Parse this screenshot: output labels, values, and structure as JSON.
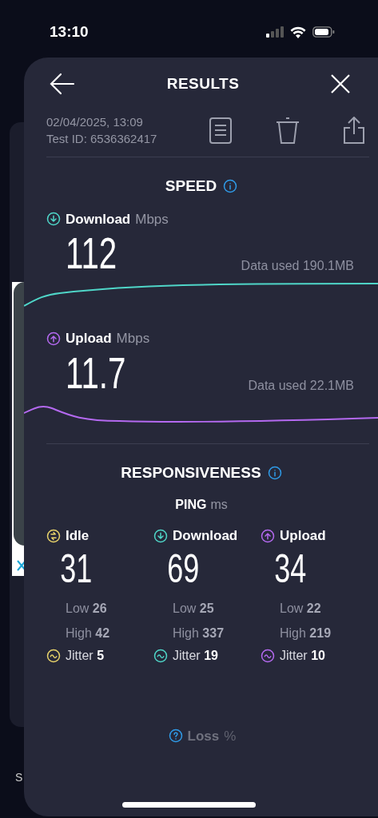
{
  "status_bar": {
    "time": "13:10"
  },
  "background_card": {
    "label": "S"
  },
  "header": {
    "title": "RESULTS"
  },
  "test_info": {
    "date": "02/04/2025, 13:09",
    "test_id": "Test ID: 6536362417"
  },
  "speed": {
    "title": "SPEED",
    "metrics": [
      {
        "kind": "download",
        "label": "Download",
        "unit": "Mbps",
        "value": "112",
        "data_used": "Data used 190.1MB",
        "color": "#4fd6c8"
      },
      {
        "kind": "upload",
        "label": "Upload",
        "unit": "Mbps",
        "value": "11.7",
        "data_used": "Data used 22.1MB",
        "color": "#b469f0"
      }
    ]
  },
  "responsiveness": {
    "title": "RESPONSIVENESS",
    "ping_label": "PING",
    "ping_unit": "ms",
    "columns": [
      {
        "kind": "idle",
        "label": "Idle",
        "value": "31",
        "low_label": "Low",
        "low": "26",
        "high_label": "High",
        "high": "42",
        "jitter_label": "Jitter",
        "jitter": "5",
        "color": "#e8d36a"
      },
      {
        "kind": "download",
        "label": "Download",
        "value": "69",
        "low_label": "Low",
        "low": "25",
        "high_label": "High",
        "high": "337",
        "jitter_label": "Jitter",
        "jitter": "19",
        "color": "#4fd6c8"
      },
      {
        "kind": "upload",
        "label": "Upload",
        "value": "34",
        "low_label": "Low",
        "low": "22",
        "high_label": "High",
        "high": "219",
        "jitter_label": "Jitter",
        "jitter": "10",
        "color": "#b469f0"
      }
    ],
    "loss_label": "Loss",
    "loss_unit": "%"
  }
}
